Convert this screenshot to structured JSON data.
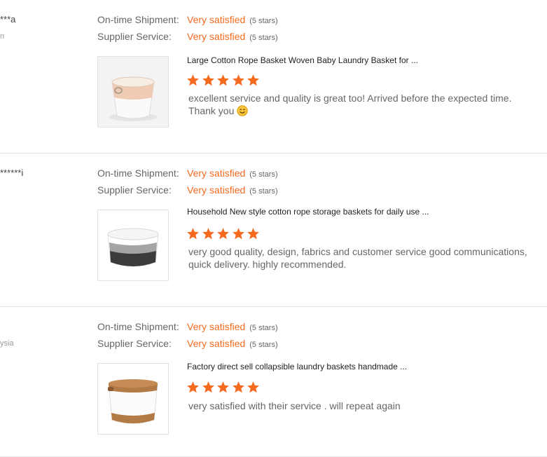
{
  "labels": {
    "shipment": "On-time Shipment:",
    "service": "Supplier Service:"
  },
  "accent_color": "#f56a1e",
  "reviews": [
    {
      "buyer": "***a",
      "country": "n",
      "shipment_rating": "Very satisfied",
      "shipment_stars": "(5 stars)",
      "service_rating": "Very satisfied",
      "service_stars": "(5 stars)",
      "product_title": "Large Cotton Rope Basket Woven Baby Laundry Basket for ...",
      "product_rating": 5,
      "comment": "excellent service and quality is great too! Arrived before the expected time. Thank you",
      "emoji": "smile-emoji-icon"
    },
    {
      "buyer": "******i",
      "country": "",
      "shipment_rating": "Very satisfied",
      "shipment_stars": "(5 stars)",
      "service_rating": "Very satisfied",
      "service_stars": "(5 stars)",
      "product_title": "Household New style cotton rope storage baskets for daily use ...",
      "product_rating": 5,
      "comment": "very good quality, design, fabrics and customer service  good communications, quick delivery. highly recommended."
    },
    {
      "buyer": "",
      "country": "ysia",
      "shipment_rating": "Very satisfied",
      "shipment_stars": "(5 stars)",
      "service_rating": "Very satisfied",
      "service_stars": "(5 stars)",
      "product_title": "Factory direct sell collapsible laundry baskets handmade ...",
      "product_rating": 5,
      "comment": "very satisfied with their service . will repeat again"
    }
  ]
}
